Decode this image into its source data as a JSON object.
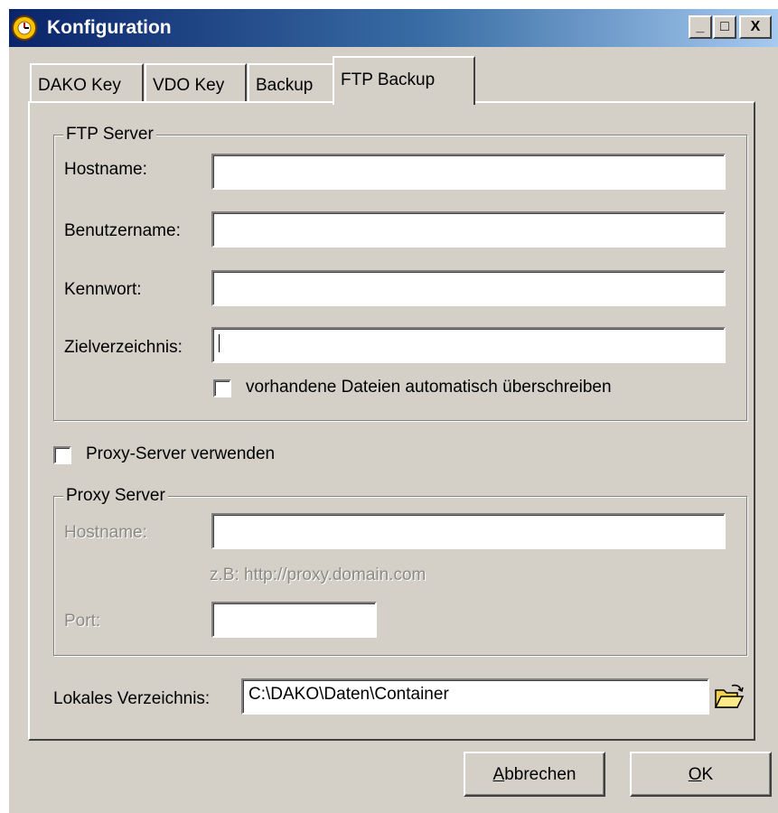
{
  "window": {
    "title": "Konfiguration",
    "controls": [
      "_",
      "□",
      "X"
    ]
  },
  "tabs": [
    {
      "label": "DAKO Key",
      "active": false
    },
    {
      "label": "VDO Key",
      "active": false
    },
    {
      "label": "Backup",
      "active": false
    },
    {
      "label": "FTP Backup",
      "active": true
    }
  ],
  "ftp_server": {
    "legend": "FTP Server",
    "hostname_label": "Hostname:",
    "hostname_value": "",
    "username_label": "Benutzername:",
    "username_value": "",
    "password_label": "Kennwort:",
    "password_value": "",
    "target_dir_label": "Zielverzeichnis:",
    "target_dir_value": "",
    "overwrite_label": "vorhandene Dateien automatisch überschreiben",
    "overwrite_checked": false
  },
  "proxy": {
    "use_proxy_label": "Proxy-Server verwenden",
    "use_proxy_checked": false,
    "legend": "Proxy Server",
    "hostname_label": "Hostname:",
    "hostname_value": "",
    "example_text": "z.B: http://proxy.domain.com",
    "port_label": "Port:",
    "port_value": ""
  },
  "local_dir": {
    "label": "Lokales Verzeichnis:",
    "value": "C:\\DAKO\\Daten\\Container",
    "browse_icon": "open-folder-icon"
  },
  "buttons": {
    "cancel_first": "A",
    "cancel_rest": "bbrechen",
    "ok_first": "O",
    "ok_rest": "K"
  },
  "colors": {
    "face": "#d4d0c8",
    "title_start": "#0a246a",
    "title_end": "#a6caf0",
    "disabled_text": "#8c8a85"
  }
}
